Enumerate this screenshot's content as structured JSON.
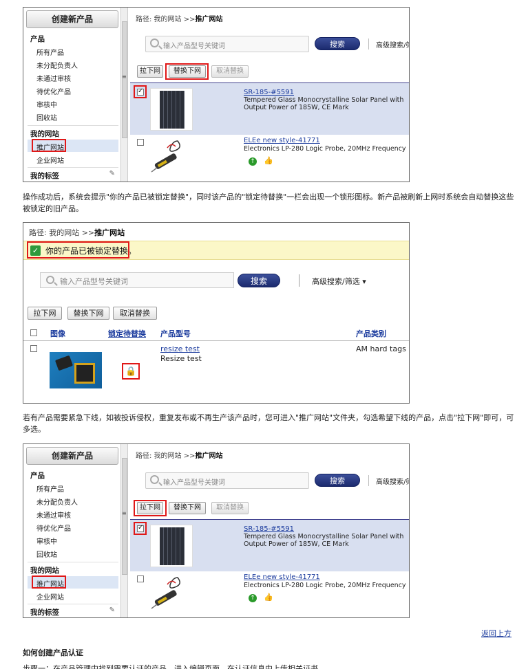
{
  "sidebar": {
    "create_button": "创建新产品",
    "group_products": "产品",
    "items_products": [
      "所有产品",
      "未分配负责人",
      "未通过审核",
      "待优化产品",
      "审核中",
      "回收站"
    ],
    "group_site": "我的网站",
    "items_site": [
      "推广网站",
      "企业网站"
    ],
    "group_tags": "我的标签"
  },
  "main": {
    "breadcrumb_prefix": "路径: 我的网站 >>",
    "breadcrumb_current": "推广网站",
    "search_placeholder": "输入产品型号关键词",
    "search_button": "搜索",
    "advanced_search_cut": "高级搜索/筛",
    "btn_pull": "拉下网",
    "btn_replace": "替换下网",
    "btn_cancel": "取消替换",
    "products": [
      {
        "title": "SR-185-#5591",
        "desc": "Tempered Glass Monocrystalline Solar Panel with Output Power of 185W, CE Mark",
        "checked": true
      },
      {
        "title": "ELEe new style-41771",
        "desc": "Electronics LP-280 Logic Probe, 20MHz Frequency",
        "checked": false
      }
    ]
  },
  "paragraph1": "操作成功后，系统会提示\"你的产品已被锁定替换\"，同时该产品的\"锁定待替换\"一栏会出现一个锁形图标。新产品被刷新上网时系统会自动替换这些被锁定的旧产品。",
  "shot2": {
    "breadcrumb_prefix": "路径: 我的网站 >>",
    "breadcrumb_current": "推广网站",
    "notice": "你的产品已被锁定替换。",
    "search_placeholder": "输入产品型号关键词",
    "search_button": "搜索",
    "advanced_search": "高级搜索/筛选 ▾",
    "btn_pull": "拉下网",
    "btn_replace": "替换下网",
    "btn_cancel": "取消替换",
    "headers": {
      "image": "图像",
      "locked": "锁定待替换",
      "model": "产品型号",
      "category": "产品类别"
    },
    "row": {
      "model_link": "resize test",
      "model_text": "Resize test",
      "category": "AM hard tags"
    }
  },
  "paragraph2": "若有产品需要紧急下线，如被投诉侵权，重复发布或不再生产该产品时，您可进入\"推广网站\"文件夹，勾选希望下线的产品，点击\"拉下网\"即可，可多选。",
  "back_to_top": "返回上方",
  "section_title": "如何创建产品认证",
  "cut_line": "步骤一：在产品管理中找到需要认证的产品，进入编辑页面，在认证信息中上传相关证书"
}
